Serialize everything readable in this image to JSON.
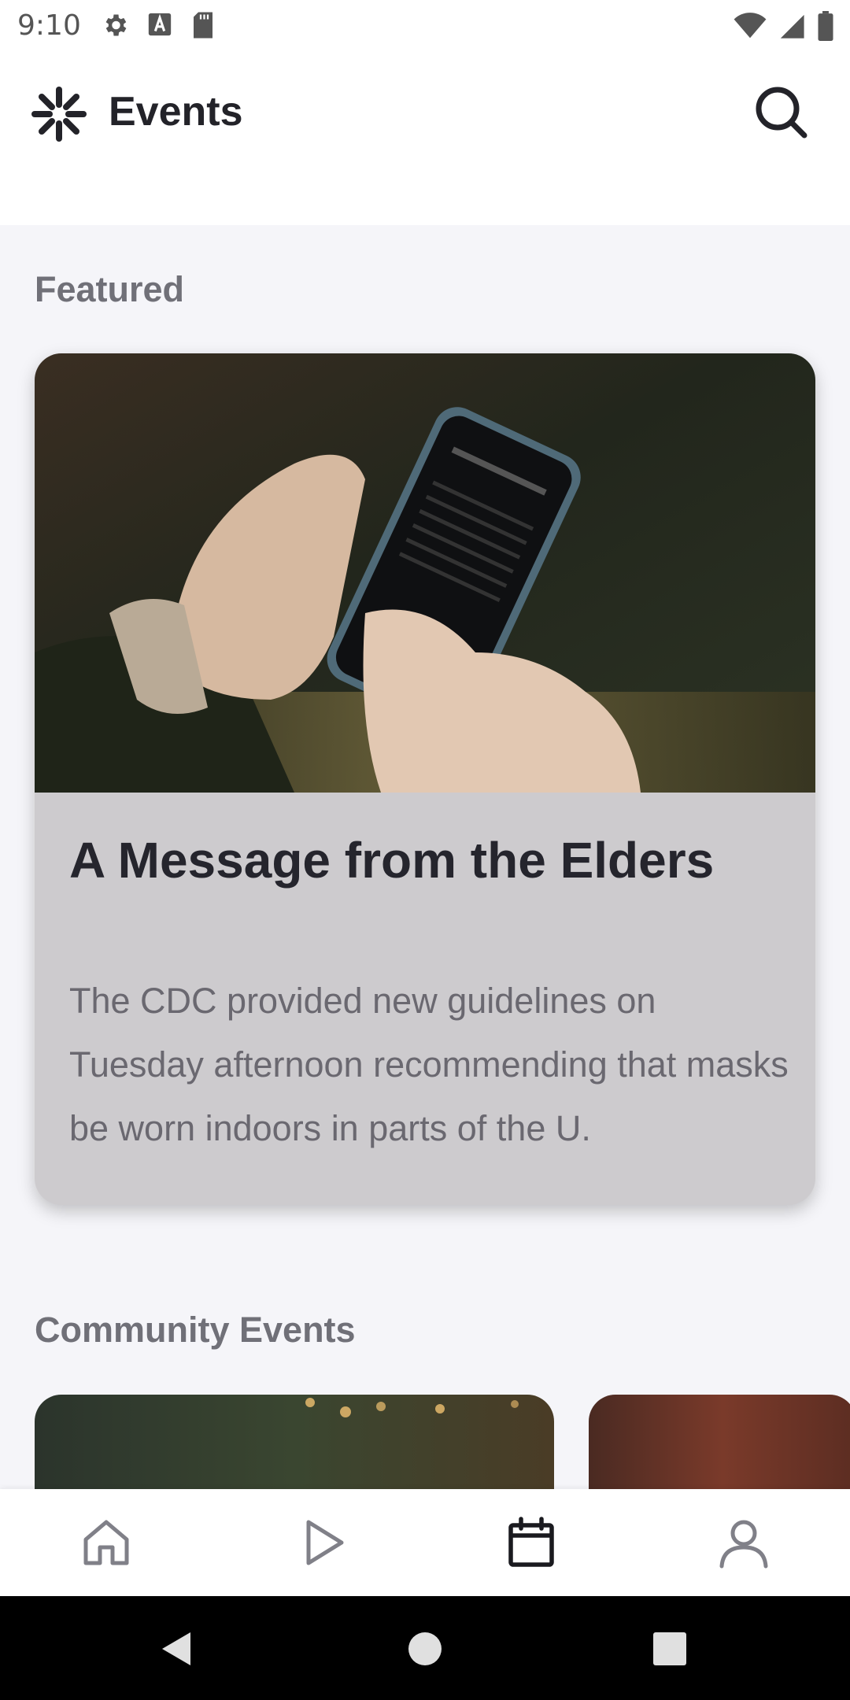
{
  "status_bar": {
    "time": "9:10",
    "left_icons": [
      "gear-icon",
      "font-a-icon",
      "sd-card-icon"
    ],
    "right_icons": [
      "wifi-icon",
      "signal-icon",
      "battery-icon"
    ]
  },
  "header": {
    "title": "Events",
    "brand_icon": "starburst-logo-icon",
    "search_icon": "search-icon"
  },
  "sections": {
    "featured": "Featured",
    "community": "Community Events"
  },
  "featured_card": {
    "title": "A Message from the Elders",
    "description": "The CDC provided new guidelines on Tuesday afternoon recommending that masks be worn indoors in parts of the U."
  },
  "bottom_nav": {
    "items": [
      "home-icon",
      "play-icon",
      "calendar-icon",
      "profile-icon"
    ],
    "active": "calendar-icon"
  },
  "system_nav": [
    "back-icon",
    "home-circle-icon",
    "recents-square-icon"
  ],
  "colors": {
    "accent": "#232329",
    "card_background": "#cdcbce",
    "page_background": "#f5f5f9"
  }
}
